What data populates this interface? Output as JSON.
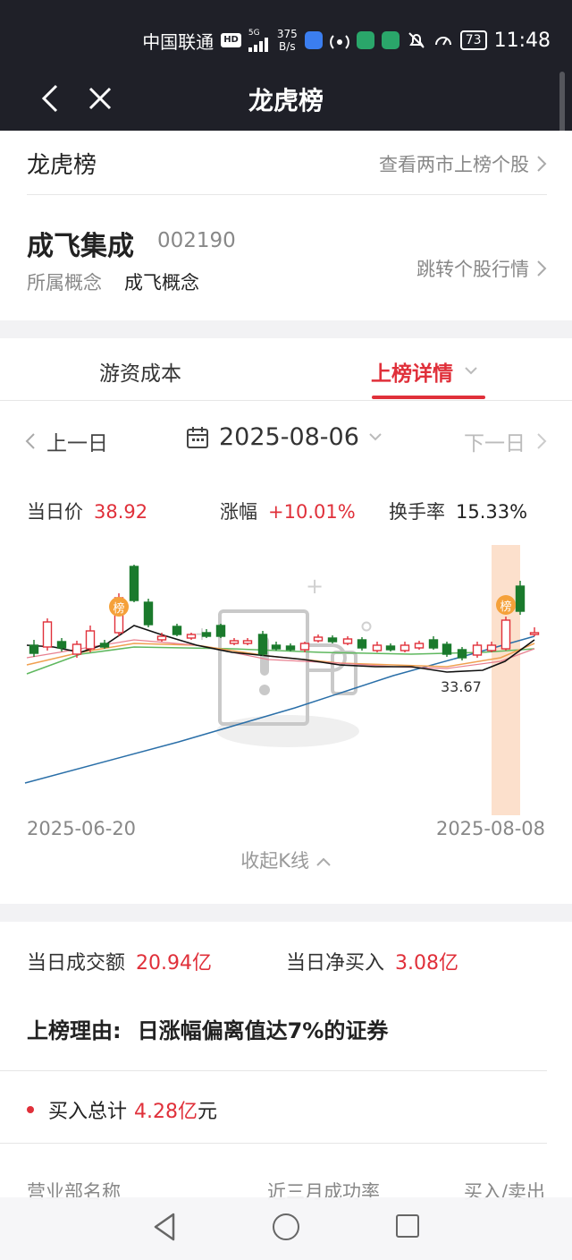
{
  "status_bar": {
    "carrier": "中国联通",
    "hd_tag": "HD",
    "network": "5G",
    "speed_value": "375",
    "speed_unit": "B/s",
    "battery": "73",
    "time": "11:48"
  },
  "nav": {
    "title": "龙虎榜"
  },
  "header_card": {
    "title": "龙虎榜",
    "view_all_link": "查看两市上榜个股",
    "stock_name": "成飞集成",
    "stock_code": "002190",
    "concept_label": "所属概念",
    "concept_value": "成飞概念",
    "jump_link": "跳转个股行情"
  },
  "tabs": [
    {
      "label": "游资成本",
      "active": false
    },
    {
      "label": "上榜详情",
      "active": true
    }
  ],
  "date_selector": {
    "prev": "上一日",
    "date": "2025-08-06",
    "next": "下一日"
  },
  "stats": {
    "price_label": "当日价",
    "price_value": "38.92",
    "change_label": "涨幅",
    "change_value": "+10.01%",
    "turnover_label": "换手率",
    "turnover_value": "15.33%"
  },
  "kline": {
    "start_date": "2025-06-20",
    "end_date": "2025-08-08",
    "marker_label": "榜",
    "low_label": "33.67",
    "collapse_label": "收起K线",
    "up_color": "#e0303a",
    "down_color": "#1a7a2c"
  },
  "summary": {
    "turnover_label": "当日成交额",
    "turnover_value": "20.94亿",
    "net_buy_label": "当日净买入",
    "net_buy_value": "3.08亿",
    "reason_label": "上榜理由:",
    "reason_value": "日涨幅偏离值达7%的证券",
    "buy_total_label": "买入总计",
    "buy_total_value": "4.28亿",
    "buy_total_unit": "元",
    "col_broker": "营业部名称",
    "col_success": "近三月成功率",
    "col_buysell": "买入/卖出"
  }
}
